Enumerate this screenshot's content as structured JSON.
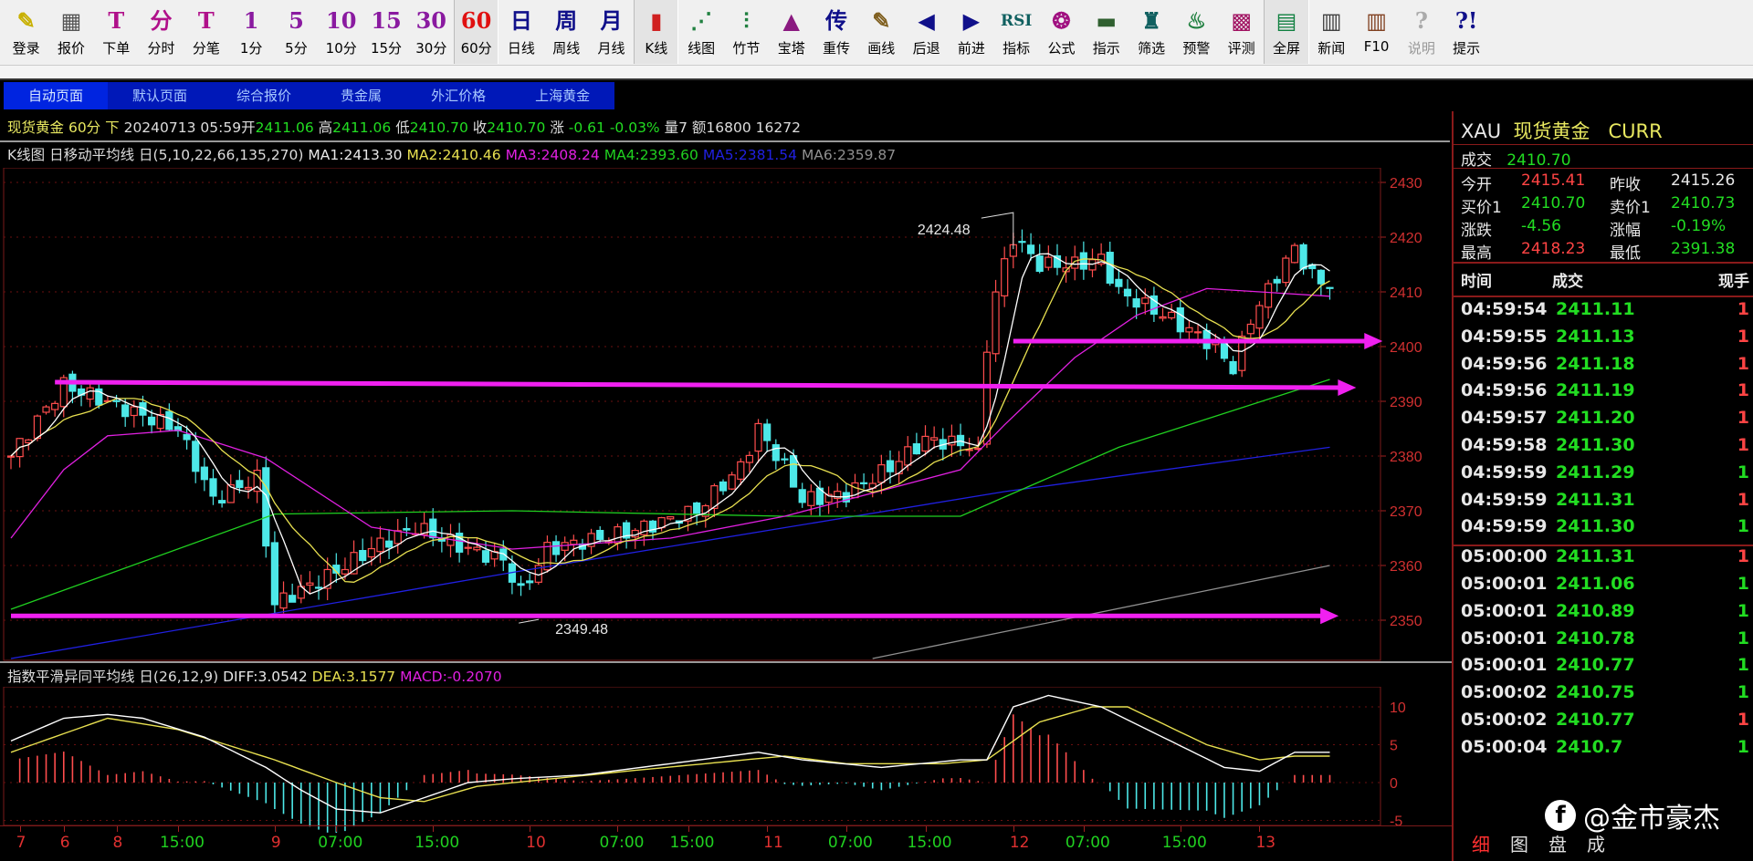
{
  "toolbar": [
    {
      "icon": "✎",
      "color": "#c8b000",
      "label": "登录",
      "name": "login"
    },
    {
      "icon": "▦",
      "color": "#555",
      "label": "报价",
      "name": "quote"
    },
    {
      "icon": "T",
      "color": "#b0108a",
      "label": "下单",
      "name": "order"
    },
    {
      "icon": "分",
      "color": "#b0108a",
      "label": "分时",
      "name": "timeshare"
    },
    {
      "icon": "T",
      "color": "#b0108a",
      "label": "分笔",
      "name": "tick"
    },
    {
      "icon": "1",
      "color": "#8a1aa0",
      "label": "1分",
      "name": "1min"
    },
    {
      "icon": "5",
      "color": "#8a1aa0",
      "label": "5分",
      "name": "5min"
    },
    {
      "icon": "10",
      "color": "#8a1aa0",
      "label": "10分",
      "name": "10min"
    },
    {
      "icon": "15",
      "color": "#8a1aa0",
      "label": "15分",
      "name": "15min"
    },
    {
      "icon": "30",
      "color": "#8a1aa0",
      "label": "30分",
      "name": "30min"
    },
    {
      "icon": "60",
      "color": "#e01010",
      "label": "60分",
      "name": "60min",
      "selected": true
    },
    {
      "icon": "日",
      "color": "#10108a",
      "label": "日线",
      "name": "daily"
    },
    {
      "icon": "周",
      "color": "#10108a",
      "label": "周线",
      "name": "weekly"
    },
    {
      "icon": "月",
      "color": "#10108a",
      "label": "月线",
      "name": "monthly"
    },
    {
      "icon": "▮",
      "color": "#d02020",
      "label": "K线",
      "name": "kline",
      "selected": true
    },
    {
      "icon": "⋰",
      "color": "#208040",
      "label": "线图",
      "name": "linechart"
    },
    {
      "icon": "⫶",
      "color": "#208040",
      "label": "竹节",
      "name": "bamboo"
    },
    {
      "icon": "▲",
      "color": "#8a1a80",
      "label": "宝塔",
      "name": "tower"
    },
    {
      "icon": "传",
      "color": "#10108a",
      "label": "重传",
      "name": "resend"
    },
    {
      "icon": "✎",
      "color": "#806020",
      "label": "画线",
      "name": "draw"
    },
    {
      "icon": "◀",
      "color": "#10108a",
      "label": "后退",
      "name": "back"
    },
    {
      "icon": "▶",
      "color": "#10108a",
      "label": "前进",
      "name": "forward"
    },
    {
      "icon": "RSI",
      "color": "#106060",
      "label": "指标",
      "name": "indicator"
    },
    {
      "icon": "❂",
      "color": "#a01080",
      "label": "公式",
      "name": "formula"
    },
    {
      "icon": "▬",
      "color": "#306030",
      "label": "指示",
      "name": "hint"
    },
    {
      "icon": "♜",
      "color": "#106060",
      "label": "筛选",
      "name": "filter"
    },
    {
      "icon": "♨",
      "color": "#208040",
      "label": "预警",
      "name": "alert"
    },
    {
      "icon": "▩",
      "color": "#a01060",
      "label": "评测",
      "name": "evaluate"
    },
    {
      "icon": "▤",
      "color": "#108040",
      "label": "全屏",
      "name": "fullscreen",
      "selected": true
    },
    {
      "icon": "▥",
      "color": "#404040",
      "label": "新闻",
      "name": "news"
    },
    {
      "icon": "▥",
      "color": "#804020",
      "label": "F10",
      "name": "f10"
    },
    {
      "icon": "?",
      "color": "#aaa",
      "label": "说明",
      "name": "help",
      "disabled": true
    },
    {
      "icon": "?!",
      "color": "#10108a",
      "label": "提示",
      "name": "tips"
    }
  ],
  "tabs": [
    "自动页面",
    "默认页面",
    "综合报价",
    "贵金属",
    "外汇价格",
    "上海黄金"
  ],
  "info": {
    "name": "现货黄金",
    "period": "60分",
    "dir": "下",
    "datetime": "20240713 05:59",
    "open_l": "开",
    "open": "2411.06",
    "high_l": "高",
    "high": "2411.06",
    "low_l": "低",
    "low": "2410.70",
    "close_l": "收",
    "close": "2410.70",
    "chg_l": "涨",
    "chg": "-0.61",
    "chg_pct": "-0.03%",
    "vol": "量7",
    "amt": "额16800",
    "extra": "16272"
  },
  "ma": {
    "title": "K线图 日移动平均线 日(5,10,22,66,135,270)",
    "ma1": "MA1:2413.30",
    "ma2": "MA2:2410.46",
    "ma3": "MA3:2408.24",
    "ma4": "MA4:2393.60",
    "ma5": "MA5:2381.54",
    "ma6": "MA6:2359.87"
  },
  "macd_header": {
    "title": "指数平滑异同平均线 日(26,12,9)",
    "diff": "DIFF:3.0542",
    "dea": "DEA:3.1577",
    "macd": "MACD:-0.2070"
  },
  "colors": {
    "up": "#ff4d4d",
    "down": "#4de8e8",
    "ma1": "#ffffff",
    "ma2": "#e8e050",
    "ma3": "#e020e0",
    "ma4": "#20d020",
    "ma5": "#2020e0",
    "ma6": "#909090",
    "arrow": "#f020f0"
  },
  "chart_data": {
    "type": "candlestick",
    "price_axis": {
      "ticks": [
        2430,
        2420,
        2410,
        2400,
        2390,
        2380,
        2370,
        2360,
        2350
      ],
      "range": [
        2347,
        2432
      ]
    },
    "close_path": [
      [
        0,
        2380
      ],
      [
        6,
        2393
      ],
      [
        14,
        2388
      ],
      [
        19,
        2385
      ],
      [
        23,
        2372
      ],
      [
        28,
        2376
      ],
      [
        30,
        2353
      ],
      [
        36,
        2358
      ],
      [
        42,
        2364
      ],
      [
        46,
        2367
      ],
      [
        52,
        2363
      ],
      [
        56,
        2361
      ],
      [
        58,
        2355
      ],
      [
        61,
        2363
      ],
      [
        70,
        2366
      ],
      [
        78,
        2370
      ],
      [
        83,
        2378
      ],
      [
        85,
        2385
      ],
      [
        88,
        2378
      ],
      [
        90,
        2372
      ],
      [
        95,
        2373
      ],
      [
        100,
        2378
      ],
      [
        104,
        2383
      ],
      [
        109,
        2382
      ],
      [
        110,
        2380
      ],
      [
        111,
        2400
      ],
      [
        112,
        2410
      ],
      [
        114,
        2420
      ],
      [
        117,
        2415
      ],
      [
        121,
        2415
      ],
      [
        124,
        2416
      ],
      [
        126,
        2410
      ],
      [
        132,
        2405
      ],
      [
        137,
        2400
      ],
      [
        139,
        2396
      ],
      [
        141,
        2405
      ],
      [
        144,
        2413
      ],
      [
        146,
        2418
      ],
      [
        148,
        2413
      ],
      [
        150,
        2410.7
      ]
    ],
    "ma4": [
      [
        0,
        2352
      ],
      [
        30,
        2369.4
      ],
      [
        57,
        2370
      ],
      [
        88,
        2369
      ],
      [
        108,
        2369
      ],
      [
        126,
        2381.6
      ],
      [
        150,
        2394
      ]
    ],
    "ma5": [
      [
        0,
        2343
      ],
      [
        58,
        2359
      ],
      [
        113,
        2373.5
      ],
      [
        150,
        2381.6
      ]
    ],
    "ma6": [
      [
        98,
        2343
      ],
      [
        150,
        2360
      ]
    ],
    "ma3": [
      [
        0,
        2365
      ],
      [
        6,
        2377.5
      ],
      [
        11,
        2383.7
      ],
      [
        19,
        2384.7
      ],
      [
        29,
        2379.6
      ],
      [
        41,
        2367
      ],
      [
        57,
        2363
      ],
      [
        75,
        2365
      ],
      [
        88,
        2369
      ],
      [
        108,
        2377.5
      ],
      [
        113,
        2385.7
      ],
      [
        121,
        2398
      ],
      [
        128,
        2405.7
      ],
      [
        136,
        2410.6
      ],
      [
        150,
        2409.2
      ]
    ],
    "annotations": [
      {
        "text": "2424.48",
        "idx": 114,
        "price": 2424.48
      },
      {
        "text": "2349.48",
        "idx": 59,
        "price": 2349.48
      }
    ],
    "arrows": [
      {
        "from": [
          5,
          2393.5
        ],
        "to": [
          153,
          2392.5
        ]
      },
      {
        "from": [
          114,
          2401
        ],
        "to": [
          156,
          2401
        ]
      },
      {
        "from": [
          0,
          2350.8
        ],
        "to": [
          151,
          2350.8
        ]
      }
    ],
    "macd_axis": {
      "ticks": [
        10,
        5,
        0,
        -5
      ]
    },
    "diff": [
      [
        0,
        5.5
      ],
      [
        6,
        8.5
      ],
      [
        11,
        9
      ],
      [
        15,
        8.5
      ],
      [
        22,
        6
      ],
      [
        29,
        2
      ],
      [
        33,
        -1
      ],
      [
        37,
        -3.5
      ],
      [
        42,
        -4
      ],
      [
        47,
        -2
      ],
      [
        52,
        0
      ],
      [
        57,
        0.5
      ],
      [
        65,
        1
      ],
      [
        75,
        2.5
      ],
      [
        85,
        4
      ],
      [
        90,
        3
      ],
      [
        99,
        2
      ],
      [
        108,
        3
      ],
      [
        111,
        3
      ],
      [
        114,
        10
      ],
      [
        118,
        11.5
      ],
      [
        124,
        10
      ],
      [
        131,
        6
      ],
      [
        138,
        2
      ],
      [
        142,
        1.5
      ],
      [
        146,
        4
      ],
      [
        150,
        4
      ]
    ],
    "dea": [
      [
        0,
        4
      ],
      [
        11,
        8.5
      ],
      [
        19,
        7
      ],
      [
        30,
        3
      ],
      [
        37,
        0
      ],
      [
        42,
        -2
      ],
      [
        47,
        -2.5
      ],
      [
        53,
        -0.5
      ],
      [
        70,
        1.5
      ],
      [
        88,
        3.5
      ],
      [
        95,
        2.5
      ],
      [
        106,
        2.5
      ],
      [
        111,
        3
      ],
      [
        117,
        8
      ],
      [
        123,
        10
      ],
      [
        127,
        10
      ],
      [
        136,
        5
      ],
      [
        142,
        3
      ],
      [
        146,
        3.5
      ],
      [
        150,
        3.5
      ]
    ],
    "x_ticks": [
      {
        "label": "7",
        "idx": 1,
        "kind": "date"
      },
      {
        "label": "6",
        "idx": 6,
        "kind": "date"
      },
      {
        "label": "8",
        "idx": 12,
        "kind": "date"
      },
      {
        "label": "15:00",
        "idx": 19,
        "kind": "time"
      },
      {
        "label": "9",
        "idx": 30,
        "kind": "date"
      },
      {
        "label": "07:00",
        "idx": 37,
        "kind": "time"
      },
      {
        "label": "15:00",
        "idx": 48,
        "kind": "time"
      },
      {
        "label": "10",
        "idx": 59,
        "kind": "date"
      },
      {
        "label": "07:00",
        "idx": 69,
        "kind": "time"
      },
      {
        "label": "15:00",
        "idx": 77,
        "kind": "time"
      },
      {
        "label": "11",
        "idx": 86,
        "kind": "date"
      },
      {
        "label": "07:00",
        "idx": 95,
        "kind": "time"
      },
      {
        "label": "15:00",
        "idx": 104,
        "kind": "time"
      },
      {
        "label": "12",
        "idx": 114,
        "kind": "date"
      },
      {
        "label": "07:00",
        "idx": 122,
        "kind": "time"
      },
      {
        "label": "15:00",
        "idx": 133,
        "kind": "time"
      },
      {
        "label": "13",
        "idx": 142,
        "kind": "date"
      }
    ]
  },
  "panel": {
    "code": "XAU",
    "name": "现货黄金",
    "type": "CURR",
    "last_l": "成交",
    "last": "2410.70",
    "open_l": "今开",
    "open": "2415.41",
    "prev_l": "昨收",
    "prev": "2415.26",
    "bid_l": "买价1",
    "bid": "2410.70",
    "ask_l": "卖价1",
    "ask": "2410.73",
    "chg_l": "涨跌",
    "chg": "-4.56",
    "pct_l": "涨幅",
    "pct": "-0.19%",
    "high_l": "最高",
    "high": "2418.23",
    "low_l": "最低",
    "low": "2391.38",
    "col_time": "时间",
    "col_price": "成交",
    "col_hand": "现手",
    "ticks": [
      {
        "t": "04:59:54",
        "p": "2411.11",
        "h": "1",
        "d": "r"
      },
      {
        "t": "04:59:55",
        "p": "2411.13",
        "h": "1",
        "d": "r"
      },
      {
        "t": "04:59:56",
        "p": "2411.18",
        "h": "1",
        "d": "r"
      },
      {
        "t": "04:59:56",
        "p": "2411.19",
        "h": "1",
        "d": "r"
      },
      {
        "t": "04:59:57",
        "p": "2411.20",
        "h": "1",
        "d": "r"
      },
      {
        "t": "04:59:58",
        "p": "2411.30",
        "h": "1",
        "d": "r"
      },
      {
        "t": "04:59:59",
        "p": "2411.29",
        "h": "1",
        "d": "g"
      },
      {
        "t": "04:59:59",
        "p": "2411.31",
        "h": "1",
        "d": "r"
      },
      {
        "t": "04:59:59",
        "p": "2411.30",
        "h": "1",
        "d": "g"
      },
      {
        "t": "05:00:00",
        "p": "2411.31",
        "h": "1",
        "d": "r"
      },
      {
        "t": "05:00:01",
        "p": "2411.06",
        "h": "1",
        "d": "g"
      },
      {
        "t": "05:00:01",
        "p": "2410.89",
        "h": "1",
        "d": "g"
      },
      {
        "t": "05:00:01",
        "p": "2410.78",
        "h": "1",
        "d": "g"
      },
      {
        "t": "05:00:01",
        "p": "2410.77",
        "h": "1",
        "d": "g"
      },
      {
        "t": "05:00:02",
        "p": "2410.75",
        "h": "1",
        "d": "g"
      },
      {
        "t": "05:00:02",
        "p": "2410.77",
        "h": "1",
        "d": "r"
      },
      {
        "t": "05:00:04",
        "p": "2410.7",
        "h": "1",
        "d": "g"
      }
    ],
    "bottom_tabs": [
      "细",
      "图",
      "盘",
      "成"
    ]
  },
  "watermark": "@金市豪杰"
}
